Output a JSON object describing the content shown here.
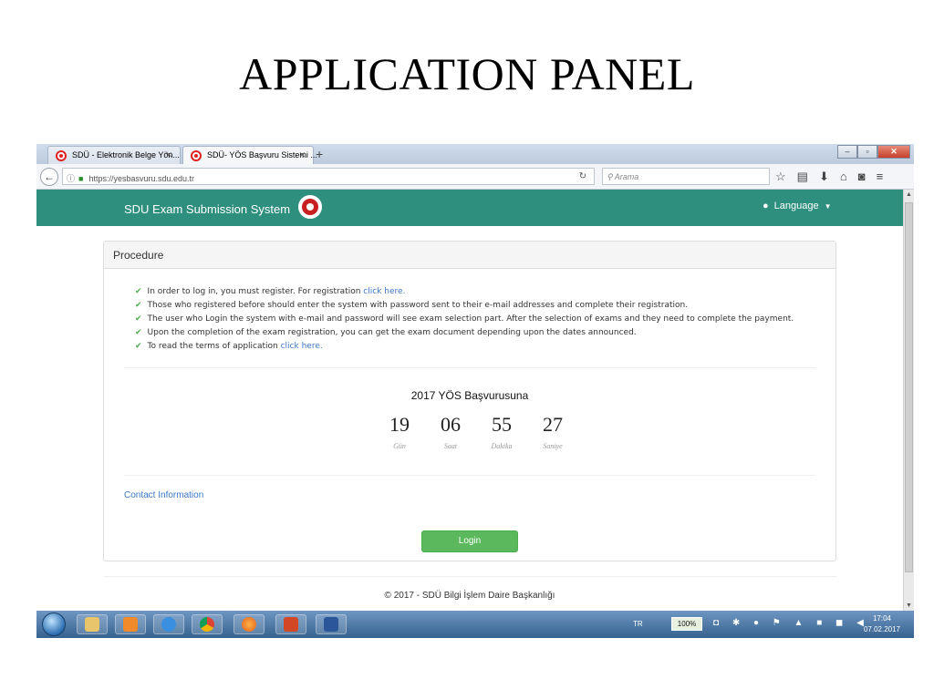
{
  "slide": {
    "title": "APPLICATION PANEL"
  },
  "browser": {
    "tabs": [
      {
        "label": "SDÜ - Elektronik Belge Yön..."
      },
      {
        "label": "SDÜ- YÖS Başvuru Sistemi ..."
      }
    ],
    "new_tab": "+",
    "url": "https://yesbasvuru.sdu.edu.tr",
    "search_placeholder": "Arama"
  },
  "header": {
    "brand": "SDU Exam Submission System",
    "language_label": "Language"
  },
  "panel": {
    "heading": "Procedure",
    "items": [
      {
        "text": "In order to log in, you must register. For registration ",
        "link": "click here."
      },
      {
        "text": "Those who registered before should enter the system with password sent to their e-mail addresses and complete their registration.",
        "link": ""
      },
      {
        "text": "The user who Login the system with e-mail and password will see exam selection part. After the selection of exams and they need to complete the payment.",
        "link": ""
      },
      {
        "text": "Upon the completion of the exam registration, you can get the exam document depending upon the dates announced.",
        "link": ""
      },
      {
        "text": "To read the terms of application ",
        "link": "click here."
      }
    ],
    "countdown_title": "2017 YÖS Başvurusuna",
    "countdown": [
      {
        "value": "19",
        "label": "Gün"
      },
      {
        "value": "06",
        "label": "Saat"
      },
      {
        "value": "55",
        "label": "Dakika"
      },
      {
        "value": "27",
        "label": "Saniye"
      }
    ],
    "contact_link": "Contact Information",
    "login_button": "Login"
  },
  "footer": {
    "text": "© 2017 - SDÜ Bilgi İşlem Daire Başkanlığı"
  },
  "taskbar": {
    "lang": "TR",
    "battery": "100%",
    "time": "17:04",
    "date": "07.02.2017"
  },
  "colors": {
    "header_bg": "#2e8f7f",
    "link": "#3c78c8",
    "login_button": "#5cb85c",
    "check": "#4cae4c"
  }
}
